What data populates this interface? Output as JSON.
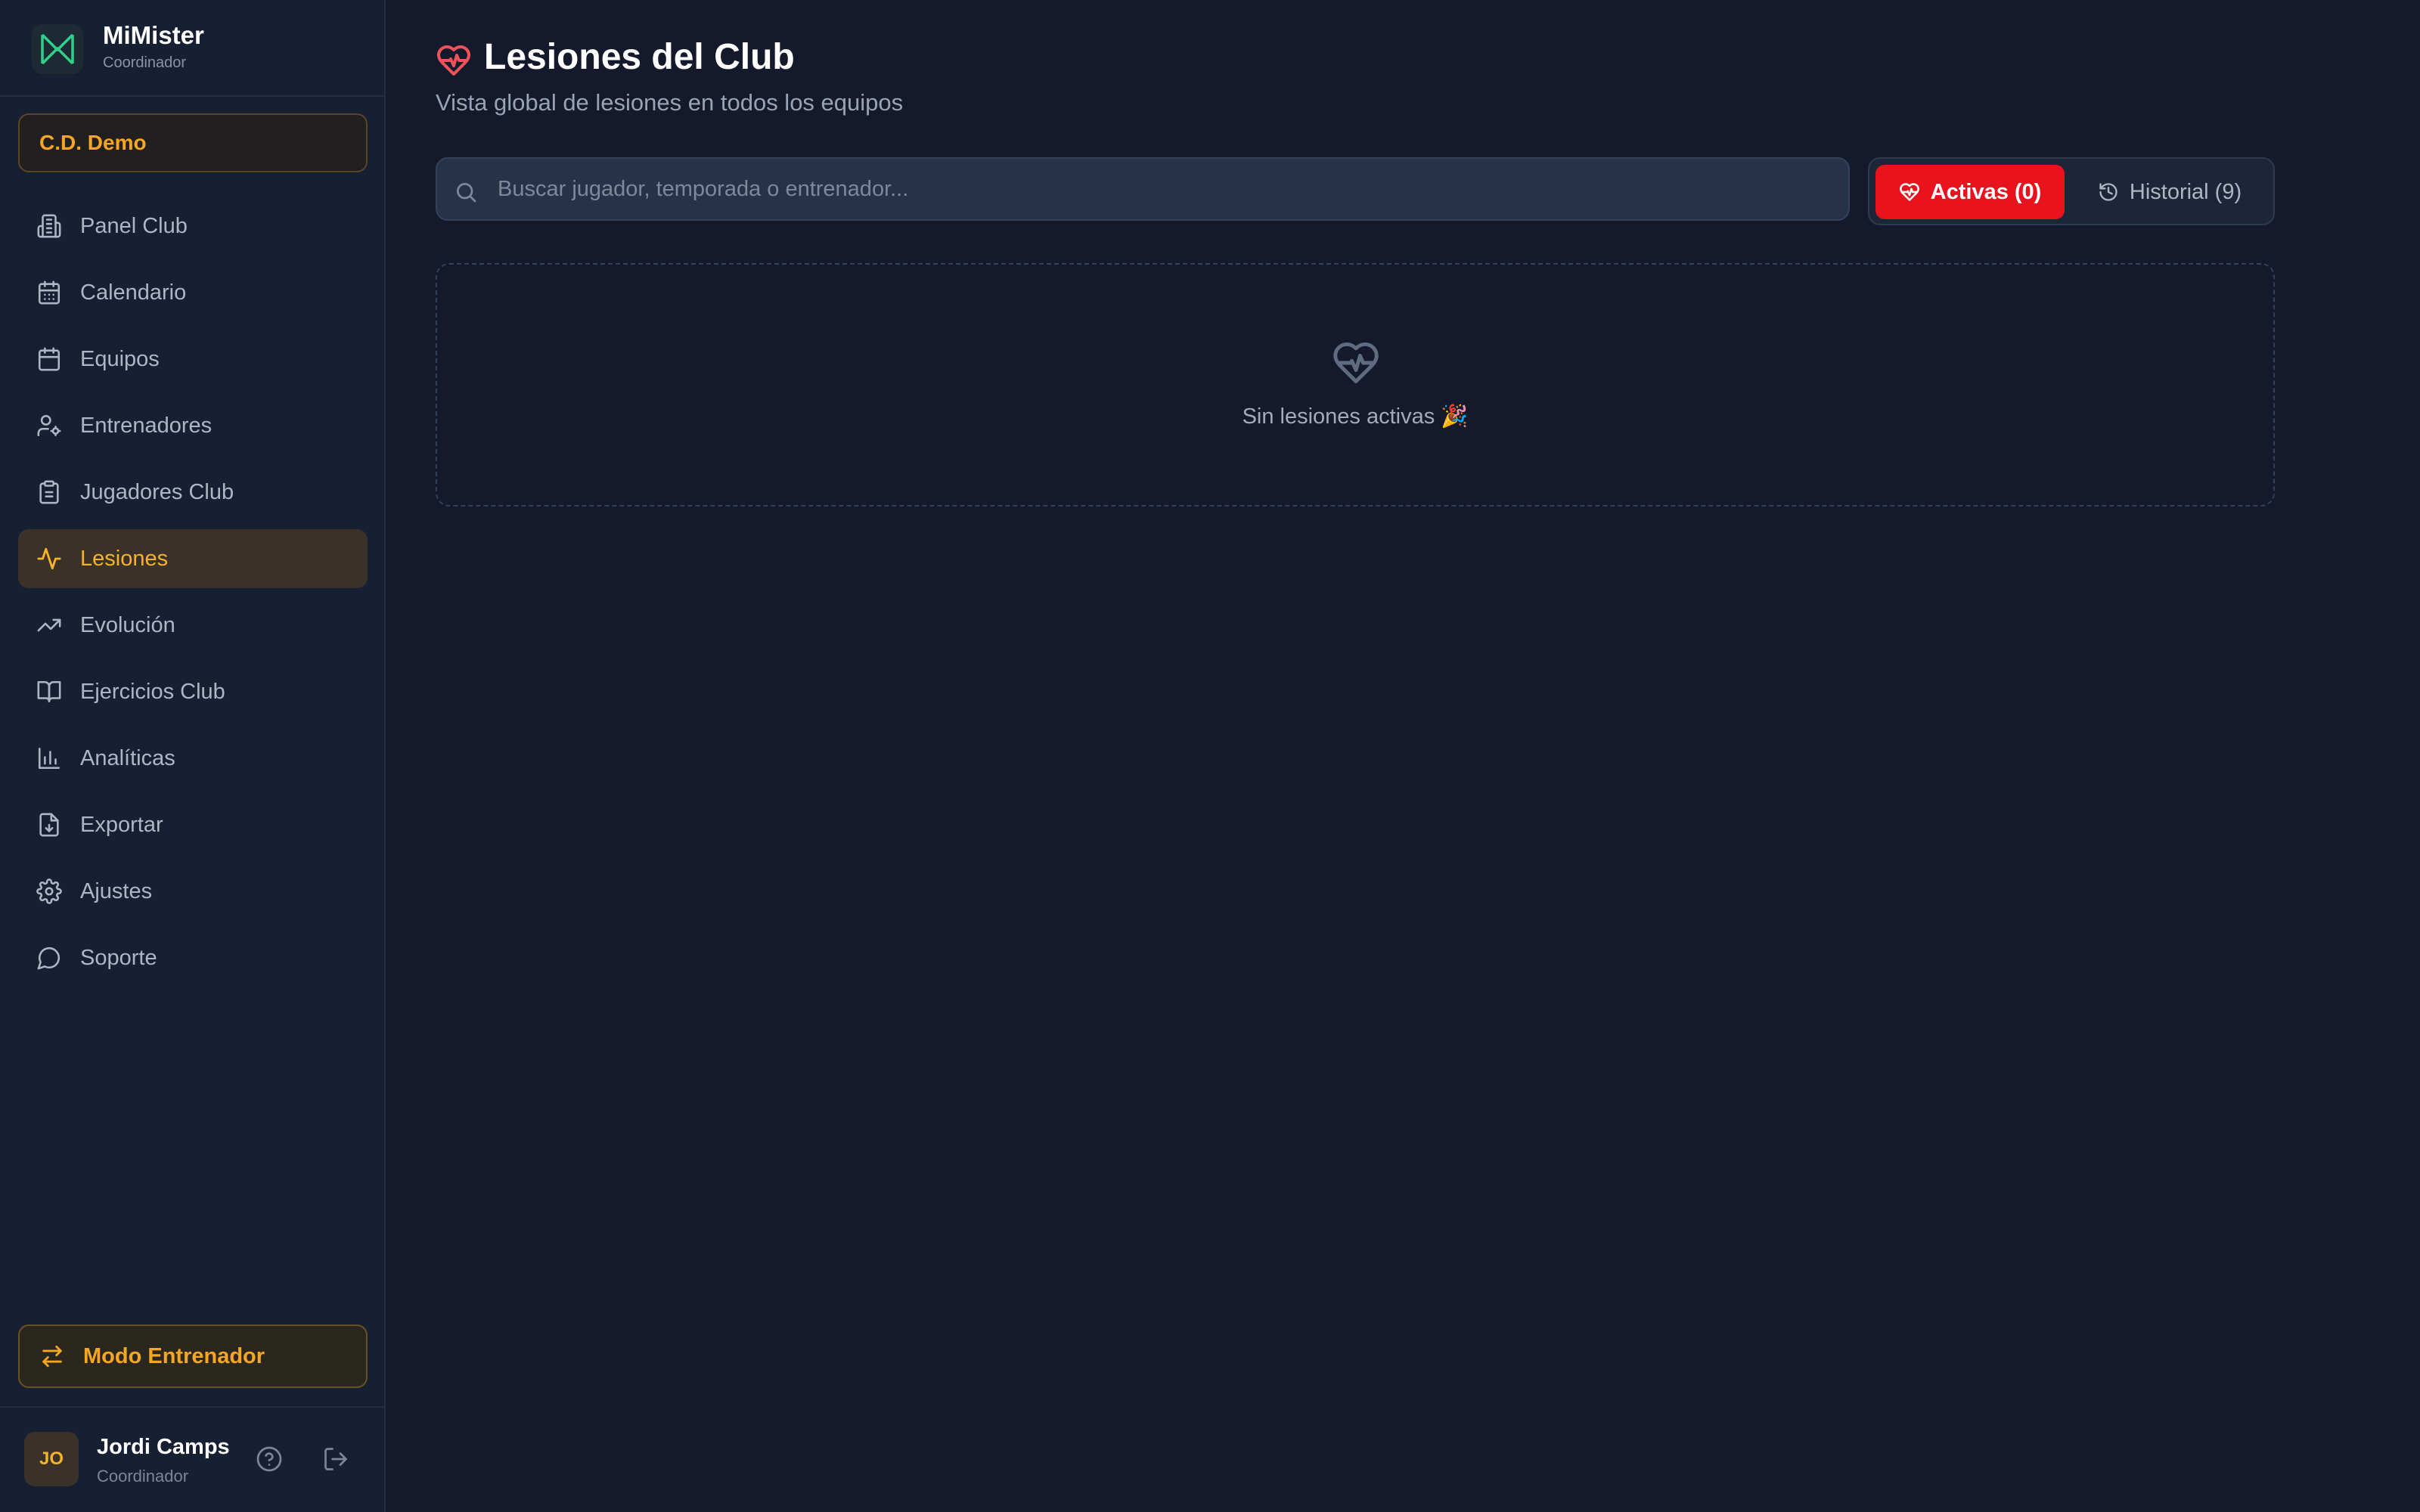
{
  "brand": {
    "name": "MiMister",
    "role": "Coordinador"
  },
  "club": {
    "name": "C.D. Demo"
  },
  "nav": {
    "items": [
      {
        "label": "Panel Club",
        "icon": "building-icon"
      },
      {
        "label": "Calendario",
        "icon": "calendar-grid-icon"
      },
      {
        "label": "Equipos",
        "icon": "calendar-icon"
      },
      {
        "label": "Entrenadores",
        "icon": "user-gear-icon"
      },
      {
        "label": "Jugadores Club",
        "icon": "clipboard-icon"
      },
      {
        "label": "Lesiones",
        "icon": "activity-icon",
        "active": true
      },
      {
        "label": "Evolución",
        "icon": "trending-up-icon"
      },
      {
        "label": "Ejercicios Club",
        "icon": "book-open-icon"
      },
      {
        "label": "Analíticas",
        "icon": "bar-chart-icon"
      },
      {
        "label": "Exportar",
        "icon": "file-download-icon"
      },
      {
        "label": "Ajustes",
        "icon": "gear-icon"
      },
      {
        "label": "Soporte",
        "icon": "message-circle-icon"
      }
    ]
  },
  "coach_mode": {
    "label": "Modo Entrenador",
    "icon": "swap-arrows-icon"
  },
  "user": {
    "initials": "JO",
    "name": "Jordi Camps",
    "role": "Coordinador"
  },
  "page": {
    "title": "Lesiones del Club",
    "subtitle": "Vista global de lesiones en todos los equipos",
    "icon": "heart-pulse-icon"
  },
  "search": {
    "placeholder": "Buscar jugador, temporada o entrenador...",
    "value": ""
  },
  "tabs": {
    "active_label": "Activas (0)",
    "history_label": "Historial (9)"
  },
  "empty_state": {
    "text": "Sin lesiones activas 🎉"
  },
  "colors": {
    "accent": "#f5a623",
    "danger": "#e8131c",
    "background": "#141a2b",
    "sidebar": "#172033"
  }
}
